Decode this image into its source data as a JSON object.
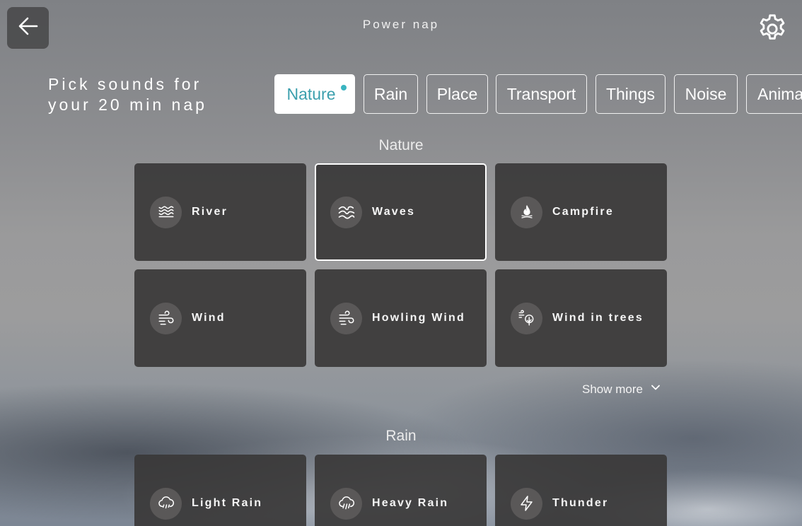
{
  "header": {
    "title": "Power nap",
    "back_icon": "arrow-left-icon",
    "settings_icon": "gear-icon"
  },
  "heading": "Pick sounds for\nyour 20 min nap",
  "tabs": [
    {
      "label": "Nature",
      "active": true,
      "indicator": true
    },
    {
      "label": "Rain"
    },
    {
      "label": "Place"
    },
    {
      "label": "Transport"
    },
    {
      "label": "Things"
    },
    {
      "label": "Noise"
    },
    {
      "label": "Animals"
    }
  ],
  "sections": [
    {
      "title": "Nature",
      "items": [
        {
          "label": "River",
          "icon": "river-icon"
        },
        {
          "label": "Waves",
          "icon": "waves-icon",
          "selected": true
        },
        {
          "label": "Campfire",
          "icon": "flame-icon"
        },
        {
          "label": "Wind",
          "icon": "wind-icon"
        },
        {
          "label": "Howling Wind",
          "icon": "wind-icon"
        },
        {
          "label": "Wind in trees",
          "icon": "wind-tree-icon"
        }
      ],
      "show_more": "Show more"
    },
    {
      "title": "Rain",
      "items": [
        {
          "label": "Light Rain",
          "icon": "cloud-rain-icon"
        },
        {
          "label": "Heavy Rain",
          "icon": "cloud-rain-icon"
        },
        {
          "label": "Thunder",
          "icon": "lightning-icon"
        }
      ]
    }
  ],
  "colors": {
    "accent": "#3b9fad",
    "card": "#3a3838"
  }
}
